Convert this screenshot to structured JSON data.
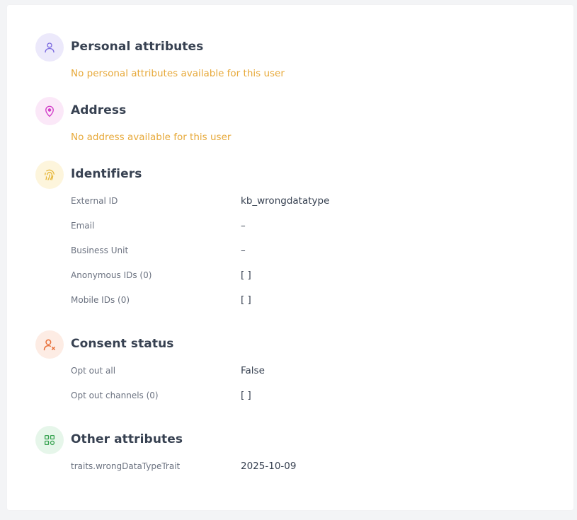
{
  "sections": {
    "personal": {
      "title": "Personal attributes",
      "empty_message": "No personal attributes available for this user",
      "icon": "user-icon",
      "icon_bg": "#ece9fb",
      "icon_color": "#7c6be0"
    },
    "address": {
      "title": "Address",
      "empty_message": "No address available for this user",
      "icon": "location-pin-icon",
      "icon_bg": "#fbe8f8",
      "icon_color": "#d23fc8"
    },
    "identifiers": {
      "title": "Identifiers",
      "icon": "fingerprint-icon",
      "icon_bg": "#fdf5dc",
      "icon_color": "#e6b83d",
      "rows": [
        {
          "label": "External ID",
          "value": "kb_wrongdatatype"
        },
        {
          "label": "Email",
          "value": "–"
        },
        {
          "label": "Business Unit",
          "value": "–"
        },
        {
          "label": "Anonymous IDs (0)",
          "value": "[ ]"
        },
        {
          "label": "Mobile IDs (0)",
          "value": "[ ]"
        }
      ]
    },
    "consent": {
      "title": "Consent status",
      "icon": "user-x-icon",
      "icon_bg": "#fdece4",
      "icon_color": "#e8703a",
      "rows": [
        {
          "label": "Opt out all",
          "value": "False"
        },
        {
          "label": "Opt out channels (0)",
          "value": "[ ]"
        }
      ]
    },
    "other": {
      "title": "Other attributes",
      "icon": "grid-apps-icon",
      "icon_bg": "#e6f6ea",
      "icon_color": "#3aa453",
      "rows": [
        {
          "label": "traits.wrongDataTypeTrait",
          "value": "2025-10-09"
        }
      ]
    }
  }
}
